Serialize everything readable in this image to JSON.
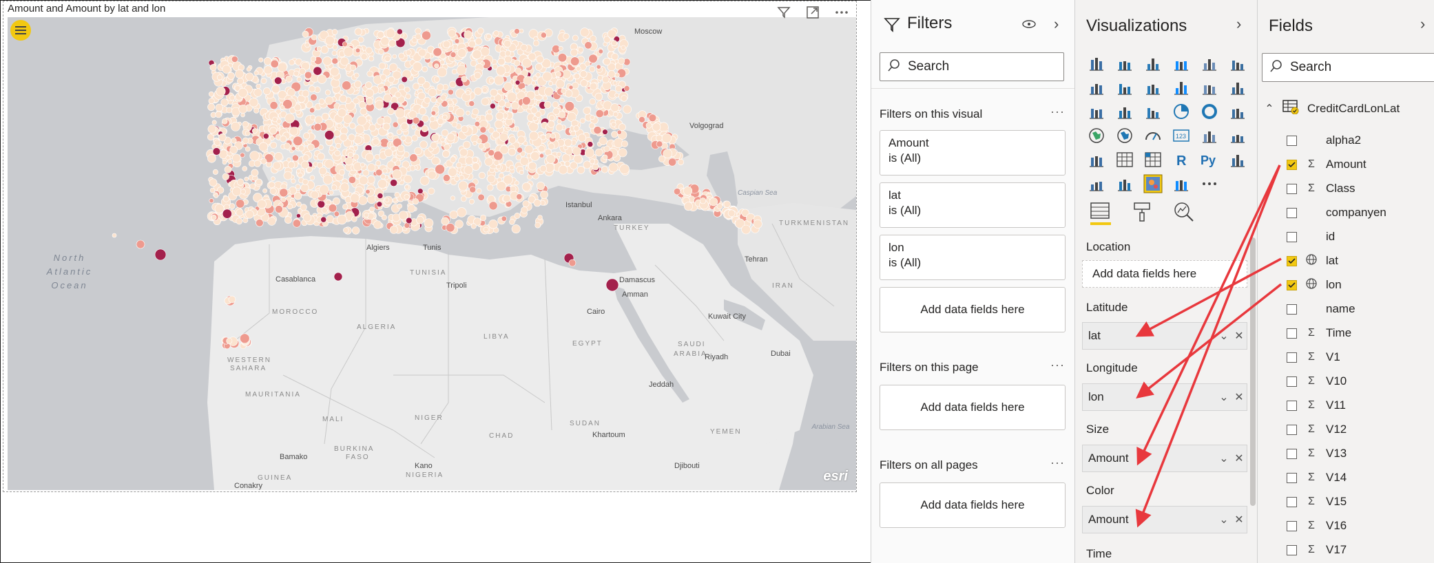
{
  "visual": {
    "title": "Amount and Amount by lat and lon",
    "map_labels": [
      {
        "text": "Moscow",
        "kind": "city"
      },
      {
        "text": "Volgograd",
        "kind": "city"
      },
      {
        "text": "Istanbul",
        "kind": "city"
      },
      {
        "text": "Ankara",
        "kind": "city"
      },
      {
        "text": "TURKEY",
        "kind": "country"
      },
      {
        "text": "TURKMENISTAN",
        "kind": "country"
      },
      {
        "text": "Tehran",
        "kind": "city"
      },
      {
        "text": "IRAN",
        "kind": "country"
      },
      {
        "text": "Algiers",
        "kind": "city"
      },
      {
        "text": "Tunis",
        "kind": "city"
      },
      {
        "text": "TUNISIA",
        "kind": "country"
      },
      {
        "text": "Casablanca",
        "kind": "city"
      },
      {
        "text": "Tripoli",
        "kind": "city"
      },
      {
        "text": "Damascus",
        "kind": "city"
      },
      {
        "text": "Amman",
        "kind": "city"
      },
      {
        "text": "MOROCCO",
        "kind": "country"
      },
      {
        "text": "ALGERIA",
        "kind": "country"
      },
      {
        "text": "LIBYA",
        "kind": "country"
      },
      {
        "text": "Cairo",
        "kind": "city"
      },
      {
        "text": "EGYPT",
        "kind": "country"
      },
      {
        "text": "Kuwait City",
        "kind": "city"
      },
      {
        "text": "SAUDI",
        "kind": "country"
      },
      {
        "text": "ARABIA",
        "kind": "country"
      },
      {
        "text": "Riyadh",
        "kind": "city"
      },
      {
        "text": "Dubai",
        "kind": "city"
      },
      {
        "text": "WESTERN",
        "kind": "country"
      },
      {
        "text": "SAHARA",
        "kind": "country"
      },
      {
        "text": "MAURITANIA",
        "kind": "country"
      },
      {
        "text": "MALI",
        "kind": "country"
      },
      {
        "text": "NIGER",
        "kind": "country"
      },
      {
        "text": "CHAD",
        "kind": "country"
      },
      {
        "text": "SUDAN",
        "kind": "country"
      },
      {
        "text": "Khartoum",
        "kind": "city"
      },
      {
        "text": "Jeddah",
        "kind": "city"
      },
      {
        "text": "YEMEN",
        "kind": "country"
      },
      {
        "text": "Bamako",
        "kind": "city"
      },
      {
        "text": "BURKINA",
        "kind": "country"
      },
      {
        "text": "FASO",
        "kind": "country"
      },
      {
        "text": "GUINEA",
        "kind": "country"
      },
      {
        "text": "Kano",
        "kind": "city"
      },
      {
        "text": "NIGERIA",
        "kind": "country"
      },
      {
        "text": "Djibouti",
        "kind": "city"
      },
      {
        "text": "Conakry",
        "kind": "city"
      },
      {
        "text": "Caspian Sea",
        "kind": "sea"
      },
      {
        "text": "Arabian Sea",
        "kind": "sea"
      }
    ],
    "ocean_label": [
      "North",
      "Atlantic",
      "Ocean"
    ],
    "attribution": "esri",
    "bubble_colors": {
      "low": "#fbe3cf",
      "mid": "#ee9a8e",
      "high": "#a3214c"
    }
  },
  "filters": {
    "title": "Filters",
    "search_placeholder": "Search",
    "on_visual": {
      "heading": "Filters on this visual",
      "cards": [
        {
          "field": "Amount",
          "state": "is (All)"
        },
        {
          "field": "lat",
          "state": "is (All)"
        },
        {
          "field": "lon",
          "state": "is (All)"
        }
      ],
      "add_label": "Add data fields here"
    },
    "on_page": {
      "heading": "Filters on this page",
      "add_label": "Add data fields here"
    },
    "on_all_pages": {
      "heading": "Filters on all pages",
      "add_label": "Add data fields here"
    }
  },
  "visualizations": {
    "title": "Visualizations",
    "wells": {
      "location": {
        "label": "Location",
        "value": "Add data fields here"
      },
      "latitude": {
        "label": "Latitude",
        "value": "lat"
      },
      "longitude": {
        "label": "Longitude",
        "value": "lon"
      },
      "size": {
        "label": "Size",
        "value": "Amount"
      },
      "color": {
        "label": "Color",
        "value": "Amount"
      },
      "time": {
        "label": "Time"
      }
    }
  },
  "fields": {
    "title": "Fields",
    "search_placeholder": "Search",
    "table": "CreditCardLonLat",
    "items": [
      {
        "name": "alpha2",
        "checked": false,
        "icon": ""
      },
      {
        "name": "Amount",
        "checked": true,
        "icon": "Σ"
      },
      {
        "name": "Class",
        "checked": false,
        "icon": "Σ"
      },
      {
        "name": "companyen",
        "checked": false,
        "icon": ""
      },
      {
        "name": "id",
        "checked": false,
        "icon": ""
      },
      {
        "name": "lat",
        "checked": true,
        "icon": "globe"
      },
      {
        "name": "lon",
        "checked": true,
        "icon": "globe"
      },
      {
        "name": "name",
        "checked": false,
        "icon": ""
      },
      {
        "name": "Time",
        "checked": false,
        "icon": "Σ"
      },
      {
        "name": "V1",
        "checked": false,
        "icon": "Σ"
      },
      {
        "name": "V10",
        "checked": false,
        "icon": "Σ"
      },
      {
        "name": "V11",
        "checked": false,
        "icon": "Σ"
      },
      {
        "name": "V12",
        "checked": false,
        "icon": "Σ"
      },
      {
        "name": "V13",
        "checked": false,
        "icon": "Σ"
      },
      {
        "name": "V14",
        "checked": false,
        "icon": "Σ"
      },
      {
        "name": "V15",
        "checked": false,
        "icon": "Σ"
      },
      {
        "name": "V16",
        "checked": false,
        "icon": "Σ"
      },
      {
        "name": "V17",
        "checked": false,
        "icon": "Σ"
      }
    ]
  },
  "annotation_color": "#e8383d"
}
